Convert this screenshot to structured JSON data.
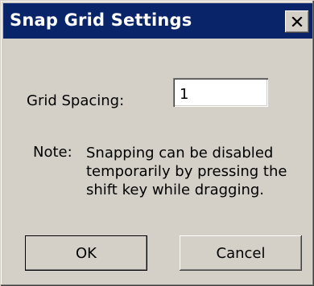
{
  "window": {
    "title": "Snap Grid Settings",
    "title_bar_color": "#0a246a",
    "face_color": "#d4d0c8"
  },
  "form": {
    "grid_spacing_label": "Grid Spacing:",
    "grid_spacing_value": "1"
  },
  "note": {
    "label": "Note:",
    "lines": [
      "Snapping can be disabled",
      "temporarily by pressing the",
      "shift key while dragging."
    ]
  },
  "buttons": {
    "ok_label": "OK",
    "cancel_label": "Cancel"
  },
  "icons": {
    "close": "close-icon"
  }
}
